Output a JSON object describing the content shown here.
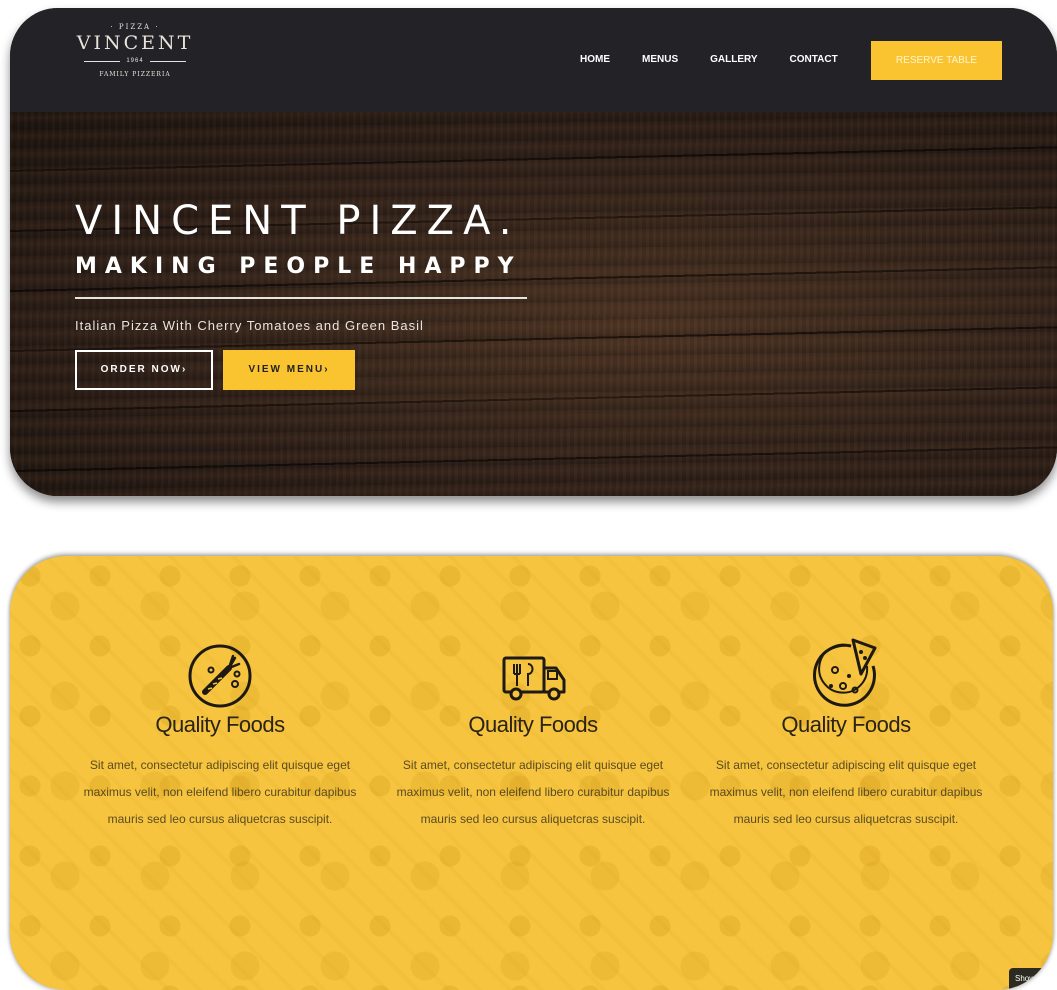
{
  "logo": {
    "top_text": "· PIZZA ·",
    "name": "VINCENT",
    "year": "1964",
    "subtitle": "FAMILY PIZZERIA"
  },
  "nav": {
    "items": [
      {
        "label": "HOME"
      },
      {
        "label": "MENUS"
      },
      {
        "label": "GALLERY"
      },
      {
        "label": "CONTACT"
      }
    ],
    "reserve_label": "RESERVE TABLE"
  },
  "hero": {
    "title": "VINCENT PIZZA.",
    "subtitle": "MAKING PEOPLE HAPPY",
    "tagline": "Italian Pizza With Cherry Tomatoes and Green Basil",
    "order_label": "ORDER NOW›",
    "menu_label": "VIEW MENU›"
  },
  "features": [
    {
      "icon": "carrot-plate-icon",
      "title": "Quality Foods",
      "text": "Sit amet, consectetur adipiscing elit quisque eget maximus velit, non eleifend libero curabitur dapibus mauris sed leo cursus aliquetcras suscipit."
    },
    {
      "icon": "food-truck-icon",
      "title": "Quality Foods",
      "text": "Sit amet, consectetur adipiscing elit quisque eget maximus velit, non eleifend libero curabitur dapibus mauris sed leo cursus aliquetcras suscipit."
    },
    {
      "icon": "pizza-icon",
      "title": "Quality Foods",
      "text": "Sit amet, consectetur adipiscing elit quisque eget maximus velit, non eleifend libero curabitur dapibus mauris sed leo cursus aliquetcras suscipit."
    }
  ],
  "show_tag": "Show",
  "colors": {
    "accent": "#f9c42f",
    "nav_bg": "#232327",
    "features_bg": "#f6c43f"
  }
}
